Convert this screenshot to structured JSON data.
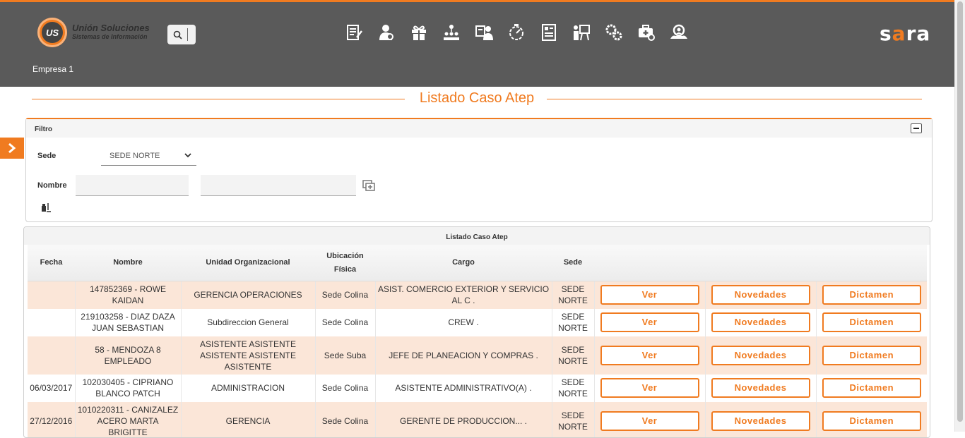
{
  "header": {
    "logo_line1": "Unión Soluciones",
    "logo_line2": "Sistemas de Información",
    "logo_mark": "US",
    "brand": "sara",
    "company": "Empresa 1",
    "nav_icons": [
      "form-edit-icon",
      "user-admin-icon",
      "gift-icon",
      "org-chart-icon",
      "people-board-icon",
      "timer-icon",
      "document-list-icon",
      "presentation-icon",
      "settings-gears-icon",
      "medical-kit-icon",
      "team-search-icon"
    ]
  },
  "page_title": "Listado Caso Atep",
  "filter": {
    "heading": "Filtro",
    "sede_label": "Sede",
    "sede_value": "SEDE NORTE",
    "nombre_label": "Nombre",
    "nombre_value": "",
    "nombre_value2": ""
  },
  "table": {
    "title": "Listado Caso Atep",
    "columns": {
      "fecha": "Fecha",
      "nombre": "Nombre",
      "unidad": "Unidad Organizacional",
      "ubicacion": "Ubicación Física",
      "cargo": "Cargo",
      "sede": "Sede"
    },
    "rows": [
      {
        "fecha": "",
        "nombre": "147852369 - ROWE KAIDAN",
        "unidad": "GERENCIA OPERACIONES",
        "ubicacion": "Sede Colina",
        "cargo": "ASIST. COMERCIO EXTERIOR Y SERVICIO AL C .",
        "sede": "SEDE NORTE",
        "ver": "Ver",
        "novedades": "Novedades",
        "dictamen": "Dictamen"
      },
      {
        "fecha": "",
        "nombre": "219103258 - DIAZ DAZA JUAN SEBASTIAN",
        "unidad": "Subdireccion General",
        "ubicacion": "Sede Colina",
        "cargo": "CREW .",
        "sede": "SEDE NORTE",
        "ver": "Ver",
        "novedades": "Novedades",
        "dictamen": "Dictamen"
      },
      {
        "fecha": "",
        "nombre": "58 - MENDOZA 8 EMPLEADO",
        "unidad": "ASISTENTE ASISTENTE ASISTENTE ASISTENTE ASISTENTE",
        "ubicacion": "Sede Suba",
        "cargo": "JEFE DE PLANEACION Y COMPRAS .",
        "sede": "SEDE NORTE",
        "ver": "Ver",
        "novedades": "Novedades",
        "dictamen": "Dictamen"
      },
      {
        "fecha": "06/03/2017",
        "nombre": "102030405 - CIPRIANO BLANCO PATCH",
        "unidad": "ADMINISTRACION",
        "ubicacion": "Sede Colina",
        "cargo": "ASISTENTE ADMINISTRATIVO(A) .",
        "sede": "SEDE NORTE",
        "ver": "Ver",
        "novedades": "Novedades",
        "dictamen": "Dictamen"
      },
      {
        "fecha": "27/12/2016",
        "nombre": "1010220311 - CANIZALEZ ACERO MARTA BRIGITTE",
        "unidad": "GERENCIA",
        "ubicacion": "Sede Colina",
        "cargo": "GERENTE DE PRODUCCION... .",
        "sede": "SEDE NORTE",
        "ver": "Ver",
        "novedades": "Novedades",
        "dictamen": "Dictamen"
      }
    ]
  }
}
